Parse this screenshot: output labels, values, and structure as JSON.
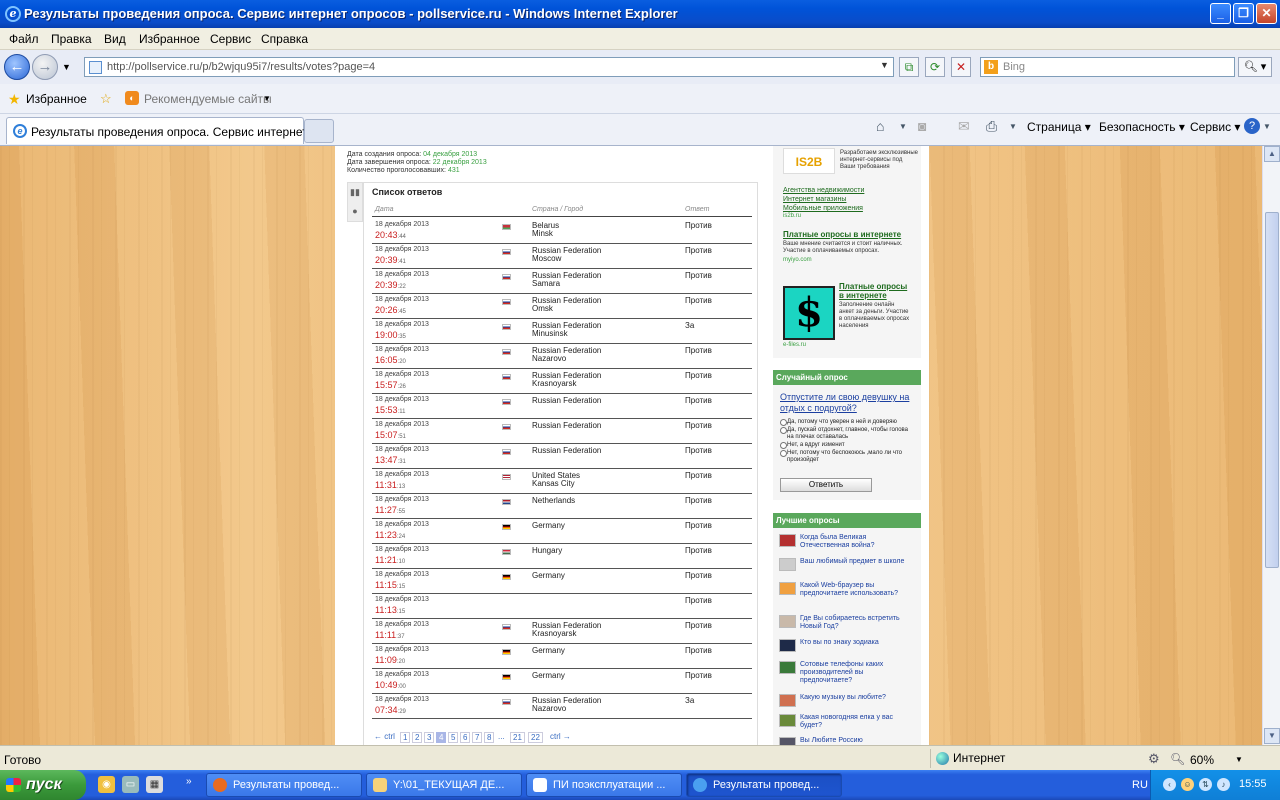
{
  "window": {
    "title": "Результаты проведения опроса. Сервис интернет опросов - pollservice.ru - Windows Internet Explorer",
    "min": "_",
    "max": "❐",
    "close": "✕"
  },
  "menu": [
    "Файл",
    "Правка",
    "Вид",
    "Избранное",
    "Сервис",
    "Справка"
  ],
  "address": {
    "url": "http://pollservice.ru/p/b2wjqu95i7/results/votes?page=4"
  },
  "search": {
    "placeholder": "Bing"
  },
  "favbar": {
    "favorites": "Избранное",
    "recommended": "Рекомендуемые сайты"
  },
  "tab": {
    "title": "Результаты проведения опроса. Сервис интернет..."
  },
  "commands": {
    "page": "Страница",
    "security": "Безопасность",
    "service": "Сервис"
  },
  "poll_meta": {
    "created_label": "Дата создания опроса:",
    "created": "04 декабря 2013",
    "finished_label": "Дата завершения опроса:",
    "finished": "22 декабря 2013",
    "votes_label": "Количество проголосовавших:",
    "votes": "431"
  },
  "answers": {
    "title": "Список ответов",
    "columns": {
      "date": "Дата",
      "country": "Страна / Город",
      "answer": "Ответ"
    },
    "rows": [
      {
        "date": "18 декабря 2013",
        "time": "20:43",
        "sec": ":44",
        "country": "Belarus",
        "city": "Minsk",
        "flag": "by",
        "answer": "Против"
      },
      {
        "date": "18 декабря 2013",
        "time": "20:39",
        "sec": ":41",
        "country": "Russian Federation",
        "city": "Moscow",
        "flag": "ru",
        "answer": "Против"
      },
      {
        "date": "18 декабря 2013",
        "time": "20:39",
        "sec": ":22",
        "country": "Russian Federation",
        "city": "Samara",
        "flag": "ru",
        "answer": "Против"
      },
      {
        "date": "18 декабря 2013",
        "time": "20:26",
        "sec": ":45",
        "country": "Russian Federation",
        "city": "Omsk",
        "flag": "ru",
        "answer": "Против"
      },
      {
        "date": "18 декабря 2013",
        "time": "19:00",
        "sec": ":35",
        "country": "Russian Federation",
        "city": "Minusinsk",
        "flag": "ru",
        "answer": "За"
      },
      {
        "date": "18 декабря 2013",
        "time": "16:05",
        "sec": ":20",
        "country": "Russian Federation",
        "city": "Nazarovo",
        "flag": "ru",
        "answer": "Против"
      },
      {
        "date": "18 декабря 2013",
        "time": "15:57",
        "sec": ":26",
        "country": "Russian Federation",
        "city": "Krasnoyarsk",
        "flag": "ru",
        "answer": "Против"
      },
      {
        "date": "18 декабря 2013",
        "time": "15:53",
        "sec": ":11",
        "country": "Russian Federation",
        "city": "",
        "flag": "ru",
        "answer": "Против"
      },
      {
        "date": "18 декабря 2013",
        "time": "15:07",
        "sec": ":51",
        "country": "Russian Federation",
        "city": "",
        "flag": "ru",
        "answer": "Против"
      },
      {
        "date": "18 декабря 2013",
        "time": "13:47",
        "sec": ":31",
        "country": "Russian Federation",
        "city": "",
        "flag": "ru",
        "answer": "Против"
      },
      {
        "date": "18 декабря 2013",
        "time": "11:31",
        "sec": ":13",
        "country": "United States",
        "city": "Kansas City",
        "flag": "us",
        "answer": "Против"
      },
      {
        "date": "18 декабря 2013",
        "time": "11:27",
        "sec": ":55",
        "country": "Netherlands",
        "city": "",
        "flag": "nl",
        "answer": "Против"
      },
      {
        "date": "18 декабря 2013",
        "time": "11:23",
        "sec": ":24",
        "country": "Germany",
        "city": "",
        "flag": "de",
        "answer": "Против"
      },
      {
        "date": "18 декабря 2013",
        "time": "11:21",
        "sec": ":10",
        "country": "Hungary",
        "city": "",
        "flag": "hu",
        "answer": "Против"
      },
      {
        "date": "18 декабря 2013",
        "time": "11:15",
        "sec": ":15",
        "country": "Germany",
        "city": "",
        "flag": "de",
        "answer": "Против"
      },
      {
        "date": "18 декабря 2013",
        "time": "11:13",
        "sec": ":15",
        "country": "",
        "city": "",
        "flag": "",
        "answer": "Против"
      },
      {
        "date": "18 декабря 2013",
        "time": "11:11",
        "sec": ":37",
        "country": "Russian Federation",
        "city": "Krasnoyarsk",
        "flag": "ru",
        "answer": "Против"
      },
      {
        "date": "18 декабря 2013",
        "time": "11:09",
        "sec": ":20",
        "country": "Germany",
        "city": "",
        "flag": "de",
        "answer": "Против"
      },
      {
        "date": "18 декабря 2013",
        "time": "10:49",
        "sec": ":00",
        "country": "Germany",
        "city": "",
        "flag": "de",
        "answer": "Против"
      },
      {
        "date": "18 декабря 2013",
        "time": "07:34",
        "sec": ":29",
        "country": "Russian Federation",
        "city": "Nazarovo",
        "flag": "ru",
        "answer": "За"
      }
    ]
  },
  "pager": {
    "prev": "← ctrl",
    "next": "ctrl →",
    "current": "4",
    "items": [
      "1",
      "2",
      "3",
      "4",
      "5",
      "6",
      "7",
      "8",
      "...",
      "21",
      "22"
    ]
  },
  "sidebar": {
    "ad1": {
      "logo": "IS2B",
      "text": "Разработаем эксклюзивные интернет-сервисы под Ваши требования",
      "links": [
        "Агентства недвижимости",
        "Интернет магазины",
        "Мобильные приложения"
      ],
      "domain": "is2b.ru"
    },
    "ad2": {
      "title": "Платные опросы в интернете",
      "text": "Ваше мнение считается и стоит наличных. Участие в оплачиваемых опросах.",
      "domain": "myiyo.com"
    },
    "ad3": {
      "title": "Платные опросы в интернете",
      "text": "Заполнение онлайн анкет за деньги. Участие в оплачиваемых опросах населения",
      "domain": "e-files.ru",
      "symbol": "$"
    },
    "random_poll": {
      "head": "Случайный опрос",
      "question": "Отпустите ли свою девушку на отдых с подругой?",
      "options": [
        "Да, потому что уверен в ней и доверяю",
        "Да, пускай отдохнет, главное, чтобы голова на плечах оставалась",
        "Нет, а вдруг изменит",
        "Нет, потому что беспокоюсь ,мало ли что произойдет"
      ],
      "button": "Ответить"
    },
    "best_polls": {
      "head": "Лучшие опросы",
      "items": [
        "Когда была Великая Отечественная война?",
        "Ваш любимый предмет в школе",
        "Какой Web-браузер вы предпочитаете использовать?",
        "Где Вы собираетесь встретить Новый Год?",
        "Кто вы по знаку зодиака",
        "Сотовые телефоны каких производителей вы предпочитаете?",
        "Какую музыку вы любите?",
        "Какая новогодняя елка у вас будет?",
        "Вы Любите Россию"
      ]
    }
  },
  "status": {
    "text": "Готово",
    "zone": "Интернет",
    "zoom": "60%"
  },
  "taskbar": {
    "start": "пуск",
    "tasks": [
      "Результаты провед...",
      "Y:\\01_ТЕКУЩАЯ ДЕ...",
      "ПИ поэксплуатации ...",
      "Результаты провед..."
    ],
    "lang": "RU",
    "clock": "15:55"
  },
  "colors": {
    "accent_green": "#5aa85c",
    "time_red": "#c81e1e",
    "title_blue": "#0053d8"
  }
}
